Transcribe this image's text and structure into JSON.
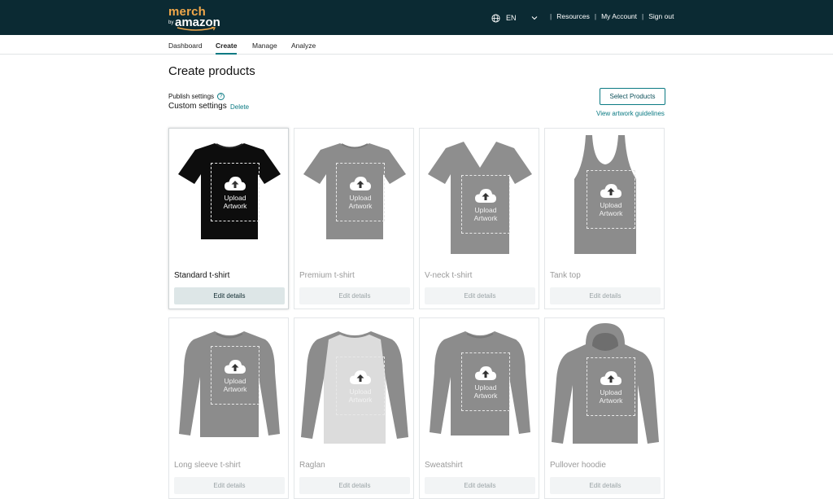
{
  "header": {
    "logo": {
      "top": "merch",
      "by": "by",
      "brand": "amazon"
    },
    "language": {
      "code": "EN"
    },
    "links": [
      "Resources",
      "My Account",
      "Sign out"
    ],
    "separator": "|"
  },
  "nav": {
    "tabs": [
      {
        "label": "Dashboard",
        "active": false
      },
      {
        "label": "Create",
        "active": true
      },
      {
        "label": "Manage",
        "active": false
      },
      {
        "label": "Analyze",
        "active": false
      }
    ]
  },
  "page": {
    "title": "Create products",
    "publish_settings_label": "Publish settings",
    "help_glyph": "?",
    "custom_settings": "Custom settings",
    "delete_label": "Delete",
    "select_products_label": "Select Products",
    "artwork_guidelines_label": "View artwork guidelines"
  },
  "upload_text": {
    "line1": "Upload",
    "line2": "Artwork"
  },
  "edit_label": "Edit details",
  "products": [
    {
      "name": "Standard t-shirt",
      "shape": "tshirt",
      "color": "#0d0d0d",
      "selected": true
    },
    {
      "name": "Premium t-shirt",
      "shape": "tshirt",
      "color": "#8c8c8c",
      "selected": false
    },
    {
      "name": "V-neck t-shirt",
      "shape": "vneck",
      "color": "#8e8e8e",
      "selected": false
    },
    {
      "name": "Tank top",
      "shape": "tank",
      "color": "#8c8c8c",
      "selected": false
    },
    {
      "name": "Long sleeve t-shirt",
      "shape": "longsleeve",
      "color": "#8c8c8c",
      "selected": false
    },
    {
      "name": "Raglan",
      "shape": "raglan",
      "color": "#8c8c8c",
      "selected": false
    },
    {
      "name": "Sweatshirt",
      "shape": "sweatshirt",
      "color": "#8c8c8c",
      "selected": false
    },
    {
      "name": "Pullover hoodie",
      "shape": "hoodie",
      "color": "#8c8c8c",
      "selected": false
    }
  ],
  "colors": {
    "header_bg": "#0b2a33",
    "accent": "#0b7a83",
    "logo_orange": "#f0a74a"
  }
}
